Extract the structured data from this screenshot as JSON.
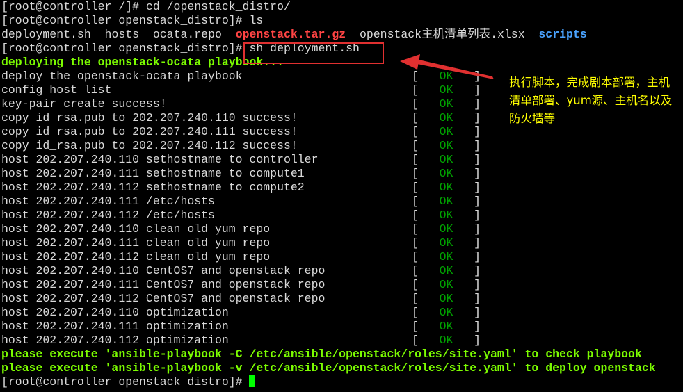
{
  "prompt": "[root@controller openstack_distro]#",
  "lines": {
    "l0": "[root@controller /]# cd /openstack_distro/",
    "l1": "[root@controller openstack_distro]# ls",
    "ls": {
      "f1": "deployment.sh",
      "f2": "hosts",
      "f3": "ocata.repo",
      "f4": "openstack.tar.gz",
      "f5": "openstack主机清单列表.xlsx",
      "f6": "scripts"
    },
    "l3_cmd": "sh deployment.sh",
    "l4": "deploying the openstack-ocata playbook...",
    "tasks": [
      "deploy the openstack-ocata playbook",
      "config host list",
      "key-pair create success!",
      "copy id_rsa.pub to 202.207.240.110 success!",
      "copy id_rsa.pub to 202.207.240.111 success!",
      "copy id_rsa.pub to 202.207.240.112 success!",
      "host 202.207.240.110 sethostname to controller",
      "host 202.207.240.111 sethostname to compute1",
      "host 202.207.240.112 sethostname to compute2",
      "host 202.207.240.111 /etc/hosts",
      "host 202.207.240.112 /etc/hosts",
      "host 202.207.240.110 clean old yum repo",
      "host 202.207.240.111 clean old yum repo",
      "host 202.207.240.112 clean old yum repo",
      "host 202.207.240.110 CentOS7 and openstack repo",
      "host 202.207.240.111 CentOS7 and openstack repo",
      "host 202.207.240.112 CentOS7 and openstack repo",
      "host 202.207.240.110 optimization",
      "host 202.207.240.111 optimization",
      "host 202.207.240.112 optimization"
    ],
    "ok_label": "OK",
    "status_open": "[   ",
    "status_close": "   ]",
    "final1": "please execute 'ansible-playbook -C /etc/ansible/openstack/roles/site.yaml' to check playbook",
    "final2": "please execute 'ansible-playbook -v /etc/ansible/openstack/roles/site.yaml' to deploy openstack"
  },
  "annotation": {
    "text": "执行脚本，完成剧本部署，主机清单部署、yum源、主机名以及防火墙等"
  },
  "colors": {
    "background": "#000000",
    "text": "#d9d9d9",
    "highlight": "#7cfc00",
    "archive": "#ff4444",
    "directory": "#4aa3ff",
    "ok": "#00a000",
    "annotation": "#ffff00",
    "box": "#e03030"
  }
}
